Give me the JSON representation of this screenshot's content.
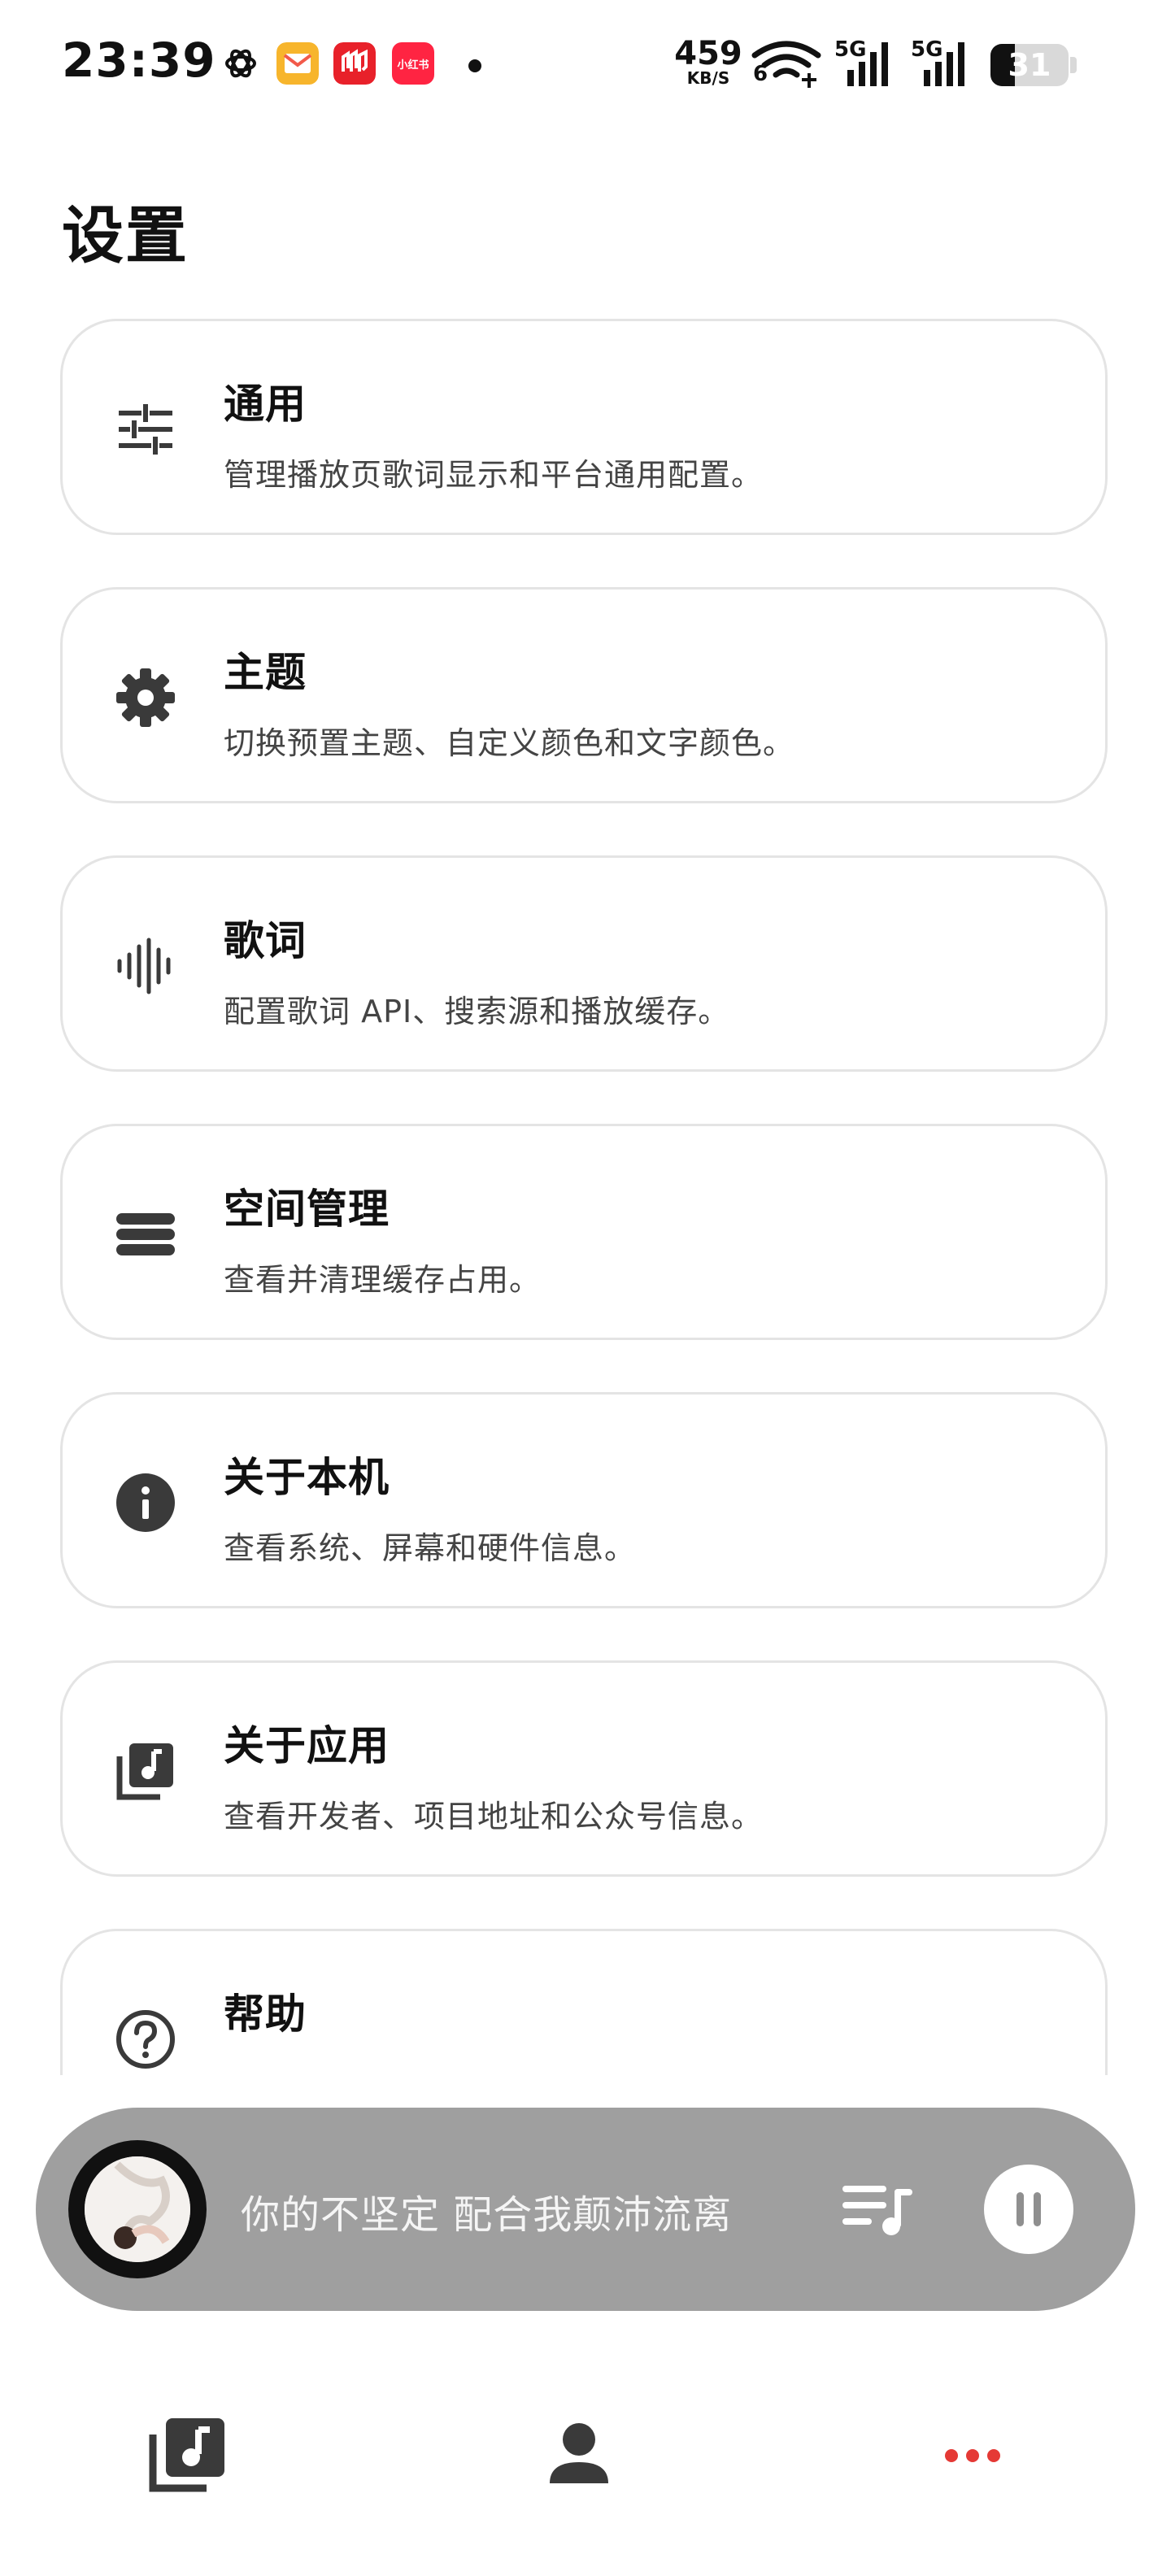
{
  "status_bar": {
    "time": "23:39",
    "net_speed": "459",
    "net_speed_unit": "KB/S",
    "wifi_sub": "6",
    "signal_1": "5G",
    "signal_2": "5G",
    "battery": "31",
    "battery_level": 0.31,
    "app_icons": [
      "openai-icon",
      "mail-app-icon",
      "meituan-app-icon",
      "xiaohongshu-app-icon"
    ],
    "xiaohongshu_label": "小红书"
  },
  "page": {
    "title": "设置"
  },
  "settings": [
    {
      "id": "general",
      "icon": "sliders-icon",
      "title": "通用",
      "desc": "管理播放页歌词显示和平台通用配置。"
    },
    {
      "id": "theme",
      "icon": "gear-icon",
      "title": "主题",
      "desc": "切换预置主题、自定义颜色和文字颜色。"
    },
    {
      "id": "lyrics",
      "icon": "waveform-icon",
      "title": "歌词",
      "desc": "配置歌词 API、搜索源和播放缓存。"
    },
    {
      "id": "storage",
      "icon": "storage-icon",
      "title": "空间管理",
      "desc": "查看并清理缓存占用。"
    },
    {
      "id": "about-device",
      "icon": "info-icon",
      "title": "关于本机",
      "desc": "查看系统、屏幕和硬件信息。"
    },
    {
      "id": "about-app",
      "icon": "music-library-icon",
      "title": "关于应用",
      "desc": "查看开发者、项目地址和公众号信息。"
    },
    {
      "id": "help",
      "icon": "help-icon",
      "title": "帮助",
      "desc": ""
    }
  ],
  "player": {
    "lyric": "你的不坚定 配合我颠沛流离",
    "state": "playing"
  },
  "bottom_nav": [
    {
      "id": "library",
      "icon": "music-library-icon",
      "active": false
    },
    {
      "id": "profile",
      "icon": "person-icon",
      "active": false
    },
    {
      "id": "more",
      "icon": "more-dots-icon",
      "active": true
    }
  ],
  "colors": {
    "accent": "#e53935",
    "icon": "#3a3a3a",
    "card_border": "#e4e4e4",
    "player_bg": "#9f9f9f"
  }
}
